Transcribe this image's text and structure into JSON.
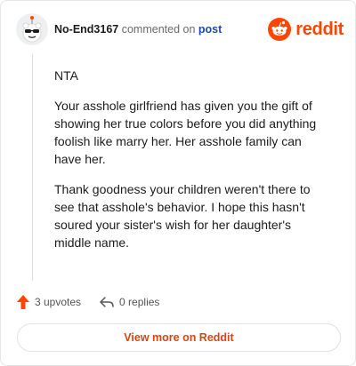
{
  "comment": {
    "username": "No-End3167",
    "action_text": "commented on",
    "post_link_label": "post",
    "paragraphs": [
      "NTA",
      "Your asshole girlfriend has given you the gift of showing her true colors before you did anything foolish like marry her. Her asshole family can have her.",
      "Thank goodness your children weren't there to see that asshole's behavior. I hope this hasn't soured your sister's wish for her daughter's middle name."
    ]
  },
  "brand": {
    "name": "reddit",
    "color": "#ff4500",
    "icon": "reddit-logo-icon"
  },
  "stats": {
    "upvotes_label": "3 upvotes",
    "replies_label": "0 replies",
    "upvote_icon": "upvote-arrow-icon",
    "reply_icon": "reply-arrow-icon"
  },
  "cta": {
    "view_more_label": "View more on Reddit"
  },
  "colors": {
    "accent": "#ff4500",
    "link": "#1a4ca8",
    "cta_text": "#d94410"
  }
}
